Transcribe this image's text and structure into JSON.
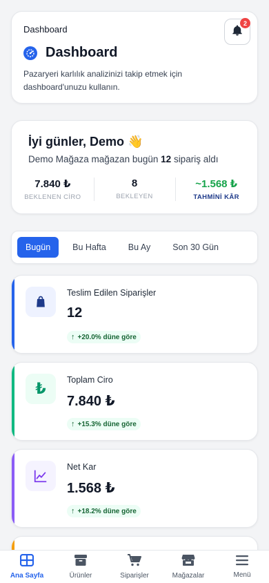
{
  "header": {
    "breadcrumb": "Dashboard",
    "title": "Dashboard",
    "description": "Pazaryeri karlılık analizinizi takip etmek için dashboard'unuzu kullanın.",
    "notification_count": "2"
  },
  "greeting": {
    "title": "İyi günler, Demo 👋",
    "sub_prefix": "Demo Mağaza mağazan bugün",
    "order_count": "12",
    "sub_suffix": "sipariş aldı",
    "stats": [
      {
        "value": "7.840 ₺",
        "label": "BEKLENEN CİRO"
      },
      {
        "value": "8",
        "label": "BEKLEYEN"
      },
      {
        "value": "~1.568 ₺",
        "label": "TAHMİNİ KÂR"
      }
    ]
  },
  "period_tabs": [
    {
      "label": "Bugün",
      "active": true
    },
    {
      "label": "Bu Hafta",
      "active": false
    },
    {
      "label": "Bu Ay",
      "active": false
    },
    {
      "label": "Son 30 Gün",
      "active": false
    }
  ],
  "metrics": [
    {
      "label": "Teslim Edilen Siparişler",
      "value": "12",
      "delta": "+20.0% düne göre",
      "icon": "shopping-bag-icon",
      "color": "#2563eb"
    },
    {
      "label": "Toplam Ciro",
      "value": "7.840 ₺",
      "delta": "+15.3% düne göre",
      "icon": "lira-icon",
      "color": "#10b981"
    },
    {
      "label": "Net Kar",
      "value": "1.568 ₺",
      "delta": "+18.2% düne göre",
      "icon": "trend-chart-icon",
      "color": "#8b5cf6"
    }
  ],
  "nav": [
    {
      "label": "Ana Sayfa",
      "icon": "home-grid-icon",
      "active": true
    },
    {
      "label": "Ürünler",
      "icon": "box-icon",
      "active": false
    },
    {
      "label": "Siparişler",
      "icon": "cart-icon",
      "active": false
    },
    {
      "label": "Mağazalar",
      "icon": "store-icon",
      "active": false
    },
    {
      "label": "Menü",
      "icon": "hamburger-icon",
      "active": false
    }
  ],
  "colors": {
    "accent": "#2563eb",
    "success": "#16a34a",
    "orange_partial": "#f59e0b"
  }
}
